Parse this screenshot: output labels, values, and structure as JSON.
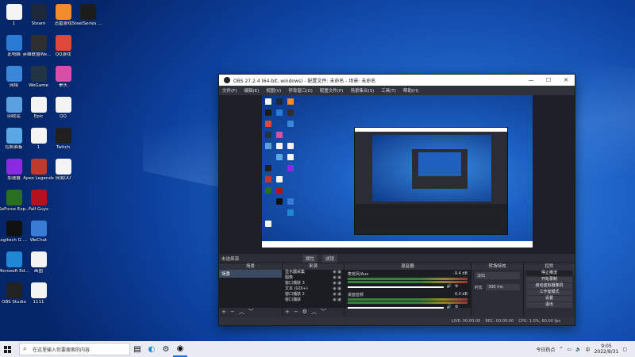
{
  "desktop_icons": [
    {
      "label": "1",
      "color": "#f3f3f3"
    },
    {
      "label": "Steam",
      "color": "#1b2838"
    },
    {
      "label": "迅雷游戏",
      "color": "#f08c2a"
    },
    {
      "label": "SteelSeries GG",
      "color": "#1c1c1c"
    },
    {
      "label": "此电脑",
      "color": "#2a7bd4"
    },
    {
      "label": "英雄联盟WeGame版",
      "color": "#2f2f2f"
    },
    {
      "label": "QQ游戏",
      "color": "#e0493a"
    },
    {
      "label": "",
      "color": "transparent"
    },
    {
      "label": "网络",
      "color": "#3a86d8"
    },
    {
      "label": "WeGame",
      "color": "#223344"
    },
    {
      "label": "拳头",
      "color": "#d94fa8"
    },
    {
      "label": "",
      "color": "transparent"
    },
    {
      "label": "回收站",
      "color": "#5ba0e0"
    },
    {
      "label": "Epic",
      "color": "#f4f4f4"
    },
    {
      "label": "QQ",
      "color": "#f4f4f4"
    },
    {
      "label": "",
      "color": "transparent"
    },
    {
      "label": "控制面板",
      "color": "#5aa8e6"
    },
    {
      "label": "1",
      "color": "#f4f4f4"
    },
    {
      "label": "Twitch",
      "color": "#1f1f1f"
    },
    {
      "label": "",
      "color": "transparent"
    },
    {
      "label": "加速器",
      "color": "#8a2be2"
    },
    {
      "label": "Apex Legends",
      "color": "#c0392b"
    },
    {
      "label": "网易UU",
      "color": "#f4f4f4"
    },
    {
      "label": "",
      "color": "transparent"
    },
    {
      "label": "GeForce Experience",
      "color": "#2a6e1f"
    },
    {
      "label": "Fall Guys",
      "color": "#b5121b"
    },
    {
      "label": "",
      "color": "transparent"
    },
    {
      "label": "",
      "color": "transparent"
    },
    {
      "label": "Logitech G HUB",
      "color": "#111111"
    },
    {
      "label": "WeChat",
      "color": "#3a7bd5"
    },
    {
      "label": "",
      "color": "transparent"
    },
    {
      "label": "",
      "color": "transparent"
    },
    {
      "label": "Microsoft Edge",
      "color": "#1e88d4"
    },
    {
      "label": "画图",
      "color": "#f4f4f4"
    },
    {
      "label": "",
      "color": "transparent"
    },
    {
      "label": "",
      "color": "transparent"
    },
    {
      "label": "OBS Studio",
      "color": "#222222"
    },
    {
      "label": "1111",
      "color": "#f4f4f4"
    }
  ],
  "obs": {
    "title": "OBS 27.2.4 (64-bit, windows) - 配置文件: 未命名 - 场景: 未命名",
    "menu": [
      "文件(F)",
      "编辑(E)",
      "视图(V)",
      "停靠窗口(D)",
      "配置文件(P)",
      "场景集合(S)",
      "工具(T)",
      "帮助(H)"
    ],
    "scene_label": "未选择源",
    "scene_buttons": [
      "属性",
      "滤镜"
    ],
    "scenes": {
      "title": "场景",
      "items": [
        "场景"
      ]
    },
    "sources": {
      "title": "来源",
      "items": [
        "显示器采集",
        "图像",
        "窗口捕获 3",
        "文本 (GDI+)",
        "窗口捕获 2",
        "窗口捕获"
      ]
    },
    "mixer": {
      "title": "混音器",
      "channels": [
        {
          "name": "麦克风/Aux",
          "level": "-9.4 dB"
        },
        {
          "name": "桌面音频",
          "level": "0.0 dB"
        }
      ]
    },
    "transitions": {
      "title": "转场特效",
      "type": "淡出",
      "duration_label": "时长",
      "duration": "300 ms"
    },
    "controls": {
      "title": "控件",
      "buttons": [
        "停止推流",
        "开始录制",
        "启动虚拟摄像机",
        "工作室模式",
        "设置",
        "退出"
      ]
    },
    "status": {
      "live": "LIVE: 00:00:00",
      "rec": "REC: 00:00:00",
      "cpu": "CPU: 1.0%, 60.00 fps"
    }
  },
  "taskbar": {
    "search_placeholder": "在这里输入你要搜索的内容",
    "weather": "今日热点",
    "time": "9:05",
    "date": "2022/8/31"
  }
}
